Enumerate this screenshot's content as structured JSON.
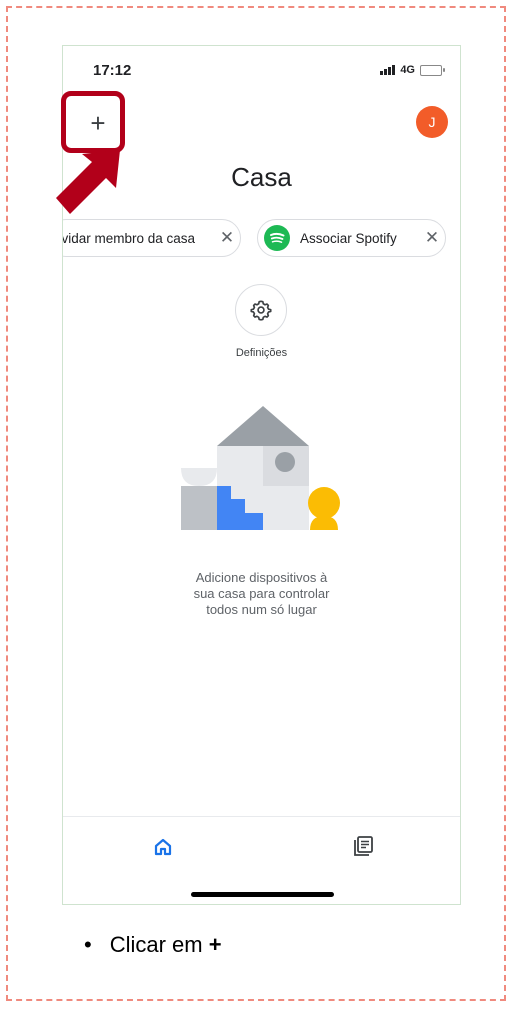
{
  "status_bar": {
    "time": "17:12",
    "network": "4G"
  },
  "header": {
    "add_symbol": "+",
    "avatar_initial": "J",
    "title": "Casa"
  },
  "chips": [
    {
      "label": "nvidar membro da casa",
      "close": "✕"
    },
    {
      "label": "Associar Spotify",
      "close": "✕"
    }
  ],
  "settings": {
    "label": "Definições"
  },
  "empty_state": {
    "message_lines": [
      "Adicione dispositivos à",
      "sua casa para controlar",
      "todos num só lugar"
    ]
  },
  "instruction": {
    "bullet": "•",
    "text": "Clicar em",
    "emphasis": "+"
  },
  "colors": {
    "accent": "#1a73e8",
    "avatar": "#f25c29",
    "highlight": "#b2001a",
    "spotify": "#1db954"
  }
}
